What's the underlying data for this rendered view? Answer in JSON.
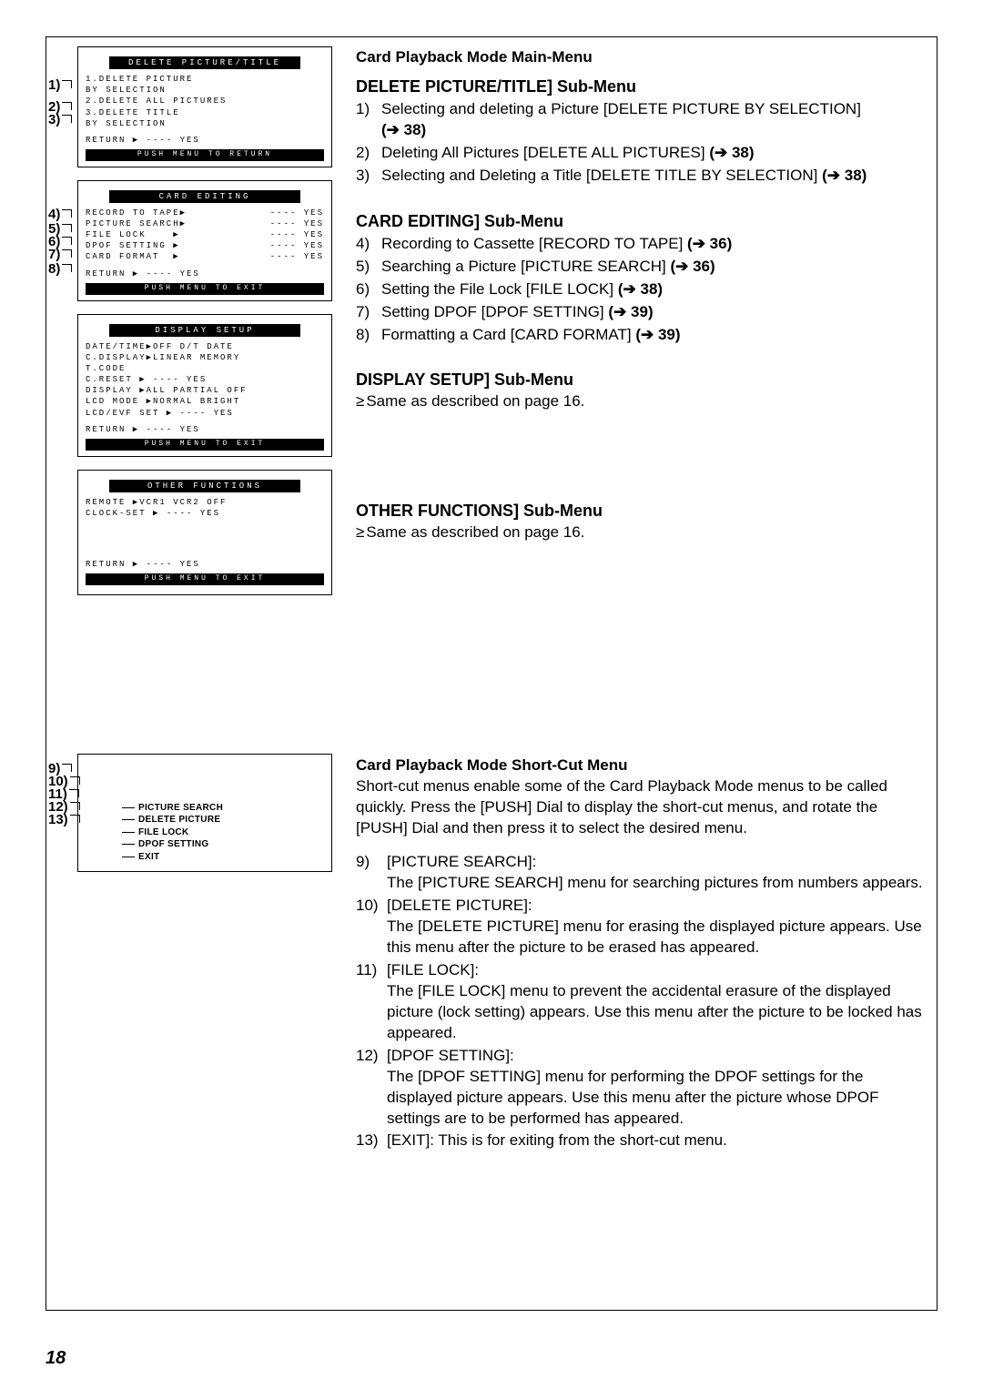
{
  "page_number": "18",
  "screens": {
    "delete": {
      "header": "DELETE PICTURE/TITLE",
      "lines": [
        "1.DELETE PICTURE",
        "        BY SELECTION",
        "2.DELETE ALL PICTURES",
        "3.DELETE TITLE",
        "        BY SELECTION"
      ],
      "return": "RETURN        ▶ ---- YES",
      "footer": "PUSH MENU TO RETURN"
    },
    "card_editing": {
      "header": "CARD EDITING",
      "rows": [
        [
          "RECORD TO TAPE▶",
          "---- YES"
        ],
        [
          "PICTURE SEARCH▶",
          "---- YES"
        ],
        [
          "FILE LOCK    ▶",
          "---- YES"
        ],
        [
          "DPOF SETTING ▶",
          "---- YES"
        ],
        [
          "CARD FORMAT  ▶",
          "---- YES"
        ]
      ],
      "return": "RETURN        ▶ ---- YES",
      "footer": "PUSH MENU TO EXIT"
    },
    "display": {
      "header": "DISPLAY SETUP",
      "rows": [
        [
          "DATE/TIME▶OFF D/T  DATE",
          ""
        ],
        [
          "C.DISPLAY▶LINEAR MEMORY",
          ""
        ],
        [
          "         T.CODE",
          ""
        ],
        [
          "C.RESET  ▶ ----   YES",
          ""
        ],
        [
          "DISPLAY  ▶ALL PARTIAL OFF",
          ""
        ],
        [
          "LCD MODE ▶NORMAL BRIGHT",
          ""
        ],
        [
          "LCD/EVF SET ▶ ---- YES",
          ""
        ]
      ],
      "return": "RETURN        ▶ ---- YES",
      "footer": "PUSH MENU TO EXIT"
    },
    "other": {
      "header": "OTHER FUNCTIONS",
      "rows": [
        [
          "REMOTE   ▶VCR1 VCR2 OFF",
          ""
        ],
        [
          "CLOCK-SET   ▶ ---- YES",
          ""
        ]
      ],
      "return": "RETURN        ▶ ---- YES",
      "footer": "PUSH MENU TO EXIT"
    },
    "shortcut": [
      "PICTURE SEARCH",
      "DELETE PICTURE",
      "FILE LOCK",
      "DPOF SETTING",
      "EXIT"
    ]
  },
  "main_menu_title": "Card Playback Mode Main-Menu",
  "sections": {
    "delete": {
      "heading": "DELETE PICTURE/TITLE] Sub-Menu",
      "items": [
        {
          "n": "1)",
          "t": "Selecting and deleting a Picture [DELETE PICTURE BY SELECTION]",
          "ref": "(➔ 38)",
          "ref_own_line": true
        },
        {
          "n": "2)",
          "t": "Deleting All Pictures [DELETE ALL PICTURES]",
          "ref": "(➔ 38)"
        },
        {
          "n": "3)",
          "t": "Selecting and Deleting a Title [DELETE TITLE BY SELECTION]",
          "ref": "(➔ 38)"
        }
      ]
    },
    "card": {
      "heading": "CARD EDITING] Sub-Menu",
      "items": [
        {
          "n": "4)",
          "t": "Recording to Cassette [RECORD TO TAPE]",
          "ref": "(➔ 36)"
        },
        {
          "n": "5)",
          "t": "Searching a Picture [PICTURE SEARCH]",
          "ref": "(➔ 36)"
        },
        {
          "n": "6)",
          "t": "Setting the File Lock [FILE LOCK]",
          "ref": "(➔ 38)"
        },
        {
          "n": "7)",
          "t": "Setting DPOF [DPOF SETTING]",
          "ref": "(➔ 39)"
        },
        {
          "n": "8)",
          "t": "Formatting a Card [CARD FORMAT]",
          "ref": "(➔ 39)"
        }
      ]
    },
    "display": {
      "heading": "DISPLAY SETUP] Sub-Menu",
      "note": "Same as described on page 16."
    },
    "other": {
      "heading": "OTHER FUNCTIONS] Sub-Menu",
      "note": "Same as described on page 16."
    }
  },
  "shortcut_title": "Card Playback Mode Short-Cut Menu",
  "shortcut_intro": "Short-cut menus enable some of the Card Playback Mode menus to be called quickly. Press the [PUSH] Dial to display the short-cut menus, and rotate the [PUSH] Dial and then press it to select the desired menu.",
  "shortcut_items": [
    {
      "n": "9)",
      "label": "[PICTURE SEARCH]:",
      "desc": "The [PICTURE SEARCH] menu for searching pictures from numbers appears."
    },
    {
      "n": "10)",
      "label": "[DELETE PICTURE]:",
      "desc": "The [DELETE PICTURE] menu for erasing the displayed picture appears. Use this menu after the picture to be erased has appeared."
    },
    {
      "n": "11)",
      "label": "[FILE LOCK]:",
      "desc": "The [FILE LOCK] menu to prevent the accidental erasure of the displayed picture (lock setting) appears. Use this menu after the picture to be locked has appeared."
    },
    {
      "n": "12)",
      "label": "[DPOF SETTING]:",
      "desc": "The [DPOF SETTING] menu for performing the DPOF settings for the displayed picture appears. Use this menu after the picture whose DPOF settings are to be performed has appeared."
    },
    {
      "n": "13)",
      "label": "[EXIT]: This is for exiting from the short-cut menu.",
      "desc": ""
    }
  ],
  "callouts": {
    "c1": "1)",
    "c2": "2)",
    "c3": "3)",
    "c4": "4)",
    "c5": "5)",
    "c6": "6)",
    "c7": "7)",
    "c8": "8)",
    "c9": "9)",
    "c10": "10)",
    "c11": "11)",
    "c12": "12)",
    "c13": "13)"
  }
}
